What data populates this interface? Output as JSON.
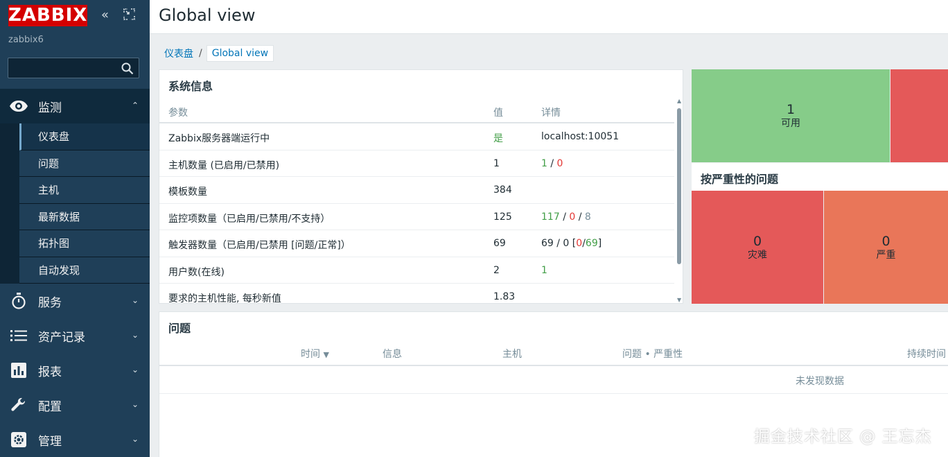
{
  "sidebar": {
    "logo": "ZABBIX",
    "server_name": "zabbix6",
    "search": {
      "value": "",
      "placeholder": ""
    },
    "menu": [
      {
        "label": "监测",
        "icon": "eye-icon",
        "open": true
      },
      {
        "label": "服务",
        "icon": "stopwatch-icon"
      },
      {
        "label": "资产记录",
        "icon": "list-icon"
      },
      {
        "label": "报表",
        "icon": "bar-chart-icon"
      },
      {
        "label": "配置",
        "icon": "wrench-icon"
      },
      {
        "label": "管理",
        "icon": "gear-icon"
      }
    ],
    "submenu": [
      "仪表盘",
      "问题",
      "主机",
      "最新数据",
      "拓扑图",
      "自动发现"
    ]
  },
  "header": {
    "title": "Global view"
  },
  "breadcrumb": {
    "dashboard": "仪表盘",
    "separator": "/",
    "current": "Global view"
  },
  "system_info": {
    "title": "系统信息",
    "columns": {
      "param": "参数",
      "value": "值",
      "details": "详情"
    },
    "rows": [
      {
        "param": "Zabbix服务器端运行中",
        "value": "是",
        "details": "localhost:10051"
      },
      {
        "param": "主机数量 (已启用/已禁用)",
        "value": "1",
        "d_enabled": "1",
        "d_sep": "/",
        "d_disabled": "0"
      },
      {
        "param": "模板数量",
        "value": "384",
        "details": ""
      },
      {
        "param": "监控项数量（已启用/已禁用/不支持）",
        "value": "125",
        "d_enabled": "117",
        "d_sep1": "/",
        "d_disabled": "0",
        "d_sep2": "/",
        "d_unsupported": "8"
      },
      {
        "param": "触发器数量（已启用/已禁用 [问题/正常]）",
        "value": "69",
        "d_prefix": "69 / 0 [",
        "d_problem": "0",
        "d_sep": "/",
        "d_ok": "69",
        "d_suffix": "]"
      },
      {
        "param": "用户数(在线)",
        "value": "2",
        "details": "1"
      },
      {
        "param": "要求的主机性能, 每秒新值",
        "value": "1.83",
        "details": ""
      }
    ]
  },
  "host_availability": {
    "available": {
      "count": "1",
      "label": "可用"
    }
  },
  "severity": {
    "title": "按严重性的问题",
    "disaster": {
      "count": "0",
      "label": "灾难"
    },
    "high": {
      "count": "0",
      "label": "严重"
    }
  },
  "problems": {
    "title": "问题",
    "columns": {
      "time": "时间",
      "info": "信息",
      "host": "主机",
      "problem": "问题 • 严重性",
      "duration": "持续时间"
    },
    "empty": "未发现数据"
  },
  "watermark": "掘金技术社区 @ 王忘杰",
  "colors": {
    "sidebar": "#1f3f58",
    "logo": "#d40000",
    "link": "#0275b8",
    "available": "#86cc89",
    "disaster": "#e45959",
    "high": "#e97659",
    "green_text": "#429e47",
    "red_text": "#e33734"
  }
}
